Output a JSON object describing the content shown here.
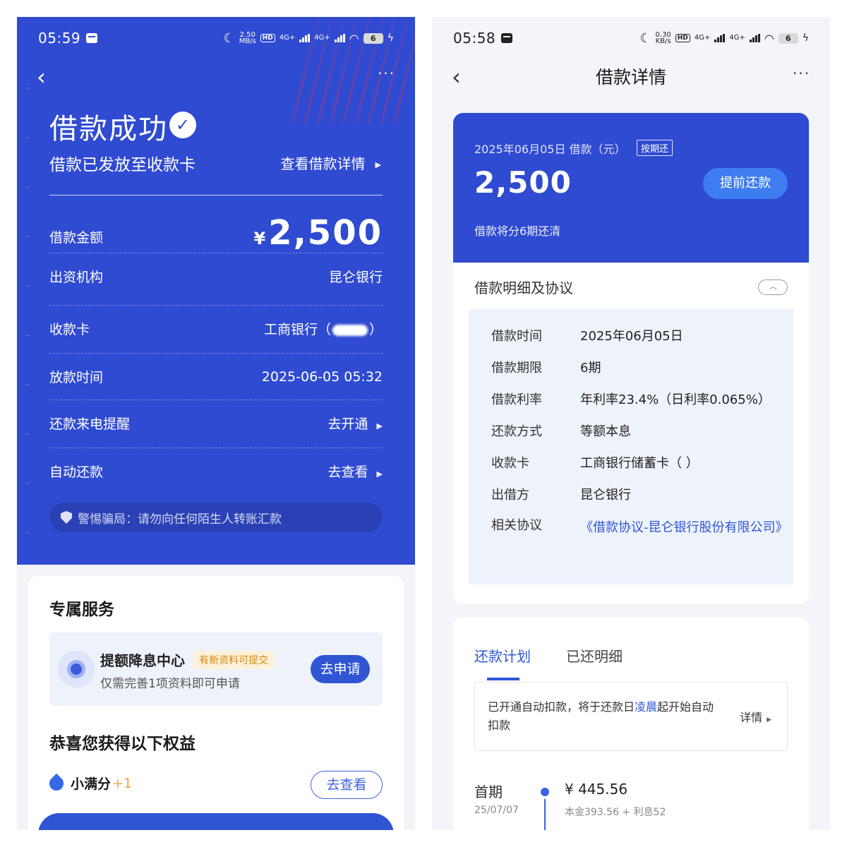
{
  "left": {
    "status": {
      "time": "05:59",
      "speed_top": "2.50",
      "speed_unit": "MB/s",
      "hd": "HD",
      "sig": "4G+",
      "battery": "6"
    },
    "title": "借款成功",
    "subtitle": "借款已发放至收款卡",
    "view_detail": "查看借款详情",
    "amount_label": "借款金额",
    "currency": "¥",
    "amount": "2,500",
    "rows": [
      {
        "label": "出资机构",
        "value": "昆仑银行"
      },
      {
        "label": "收款卡",
        "value_prefix": "工商银行（",
        "value_suffix": "）"
      },
      {
        "label": "放款时间",
        "value": "2025-06-05 05:32"
      },
      {
        "label": "还款来电提醒",
        "value": "去开通"
      },
      {
        "label": "自动还款",
        "value": "去查看"
      }
    ],
    "warning": "警惕骗局：请勿向任何陌生人转账汇款",
    "services_title": "专属服务",
    "service": {
      "title": "提额降息中心",
      "badge": "有新资料可提交",
      "desc": "仅需完善1项资料即可申请",
      "button": "去申请"
    },
    "benefits_title": "恭喜您获得以下权益",
    "points": {
      "label": "小满分",
      "plus": "+1",
      "button": "去查看"
    }
  },
  "right": {
    "status": {
      "time": "05:58",
      "speed_top": "0.30",
      "speed_unit": "KB/s",
      "hd": "HD",
      "sig": "4G+",
      "battery": "6"
    },
    "title": "借款详情",
    "date": "2025年06月05日 借款（元）",
    "badge": "按期还",
    "amount": "2,500",
    "prepay": "提前还款",
    "plan_note": "借款将分6期还清",
    "section_title": "借款明细及协议",
    "details": [
      {
        "label": "借款时间",
        "value": "2025年06月05日"
      },
      {
        "label": "借款期限",
        "value": "6期"
      },
      {
        "label": "借款利率",
        "value": "年利率23.4%（日利率0.065%）"
      },
      {
        "label": "还款方式",
        "value": "等额本息"
      },
      {
        "label": "收款卡",
        "value": "工商银行储蓄卡（     ）"
      },
      {
        "label": "出借方",
        "value": "昆仑银行"
      },
      {
        "label": "相关协议",
        "value": "《借款协议-昆仑银行股份有限公司》"
      }
    ],
    "tabs": [
      "还款计划",
      "已还明细"
    ],
    "auto_text_1": "已开通自动扣款，将于还款日",
    "auto_text_hl": "凌晨",
    "auto_text_2": "起开始自动扣款",
    "auto_detail": "详情",
    "plan": {
      "period": "首期",
      "date": "25/07/07",
      "amount": "¥ 445.56",
      "breakdown": "本金393.56 + 利息52"
    }
  }
}
